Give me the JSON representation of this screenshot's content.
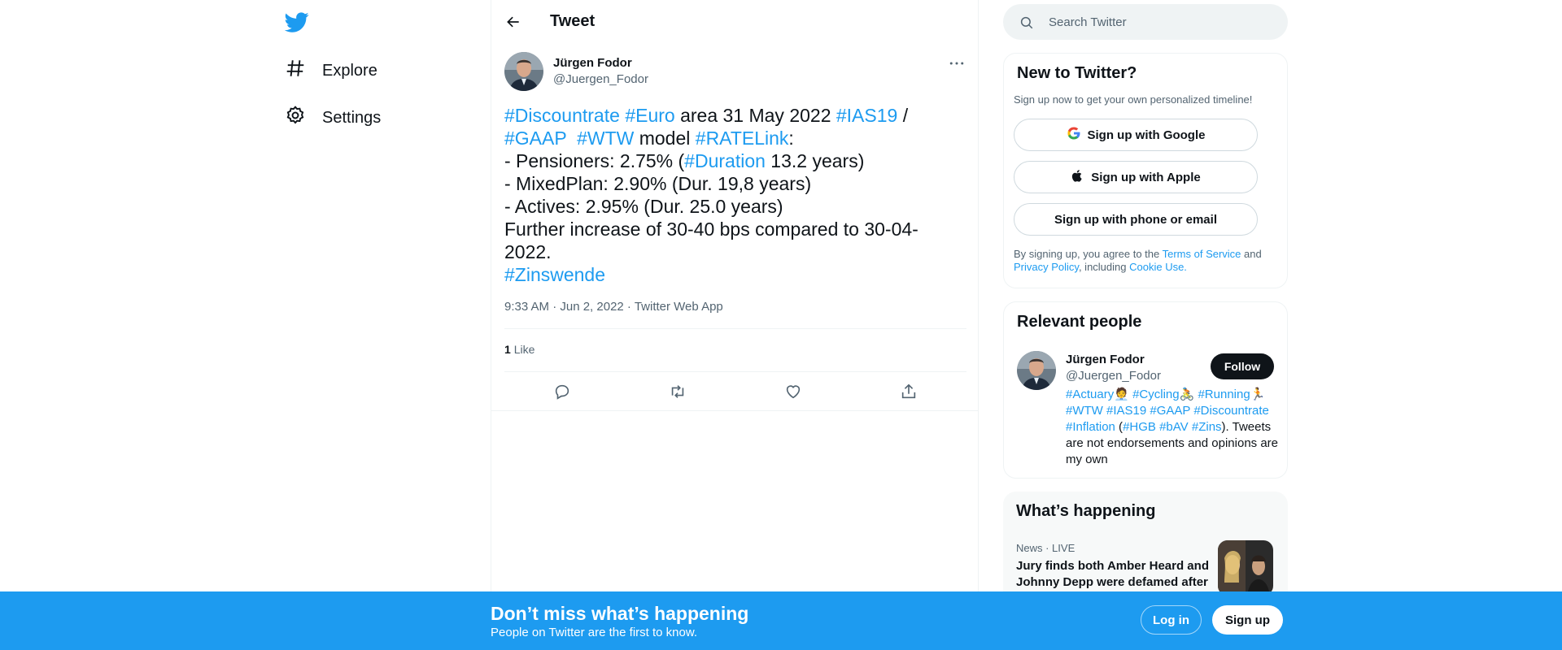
{
  "nav": {
    "items": [
      {
        "label": "Explore",
        "icon": "hashtag-icon"
      },
      {
        "label": "Settings",
        "icon": "gear-icon"
      }
    ]
  },
  "header": {
    "title": "Tweet"
  },
  "tweet": {
    "author_name": "Jürgen Fodor",
    "author_handle": "@Juergen_Fodor",
    "segments": [
      {
        "text": "#Discountrate",
        "tag": true
      },
      {
        "text": " ",
        "tag": false
      },
      {
        "text": "#Euro",
        "tag": true
      },
      {
        "text": " area 31 May 2022 ",
        "tag": false
      },
      {
        "text": "#IAS19",
        "tag": true
      },
      {
        "text": " /\n",
        "tag": false
      },
      {
        "text": "#GAAP",
        "tag": true
      },
      {
        "text": "  ",
        "tag": false
      },
      {
        "text": "#WTW",
        "tag": true
      },
      {
        "text": " model ",
        "tag": false
      },
      {
        "text": "#RATELink",
        "tag": true
      },
      {
        "text": ":\n- Pensioners: 2.75% (",
        "tag": false
      },
      {
        "text": "#Duration",
        "tag": true
      },
      {
        "text": " 13.2 years)\n- MixedPlan: 2.90% (Dur. 19,8 years)\n- Actives: 2.95% (Dur. 25.0 years)\nFurther increase of 30-40 bps compared to 30-04-2022.\n",
        "tag": false
      },
      {
        "text": "#Zinswende",
        "tag": true
      }
    ],
    "meta": "9:33 AM · Jun 2, 2022 · Twitter Web App",
    "like_count": "1",
    "like_label": "Like"
  },
  "sidebar": {
    "search_placeholder": "Search Twitter",
    "new_to_twitter": {
      "title": "New to Twitter?",
      "subtitle": "Sign up now to get your own personalized timeline!",
      "google_btn": "Sign up with Google",
      "apple_btn": "Sign up with Apple",
      "phone_btn": "Sign up with phone or email",
      "legal_prefix": "By signing up, you agree to the ",
      "terms": "Terms of Service",
      "and": " and ",
      "privacy": "Privacy Policy",
      "including": ", including ",
      "cookie": "Cookie Use."
    },
    "relevant_people": {
      "title": "Relevant people",
      "name": "Jürgen Fodor",
      "handle": "@Juergen_Fodor",
      "follow": "Follow",
      "bio_segments": [
        {
          "text": "#Actuary",
          "tag": true
        },
        {
          "text": "🧑‍💼 ",
          "tag": false
        },
        {
          "text": "#Cycling",
          "tag": true
        },
        {
          "text": "🚴 ",
          "tag": false
        },
        {
          "text": "#Running",
          "tag": true
        },
        {
          "text": "🏃 ",
          "tag": false
        },
        {
          "text": "#WTW",
          "tag": true
        },
        {
          "text": " ",
          "tag": false
        },
        {
          "text": "#IAS19",
          "tag": true
        },
        {
          "text": " ",
          "tag": false
        },
        {
          "text": "#GAAP",
          "tag": true
        },
        {
          "text": " ",
          "tag": false
        },
        {
          "text": "#Discountrate",
          "tag": true
        },
        {
          "text": " ",
          "tag": false
        },
        {
          "text": "#Inflation",
          "tag": true
        },
        {
          "text": " (",
          "tag": false
        },
        {
          "text": "#HGB",
          "tag": true
        },
        {
          "text": " ",
          "tag": false
        },
        {
          "text": "#bAV",
          "tag": true
        },
        {
          "text": " ",
          "tag": false
        },
        {
          "text": "#Zins",
          "tag": true
        },
        {
          "text": "). Tweets are not endorsements and opinions are my own",
          "tag": false
        }
      ]
    },
    "happening": {
      "title": "What’s happening",
      "news_meta": "News · LIVE",
      "news_title": "Jury finds both Amber Heard and Johnny Depp were defamed after"
    }
  },
  "bottom_bar": {
    "title": "Don’t miss what’s happening",
    "subtitle": "People on Twitter are the first to know.",
    "login": "Log in",
    "signup": "Sign up"
  },
  "colors": {
    "accent": "#1d9bf0",
    "text": "#0f1419",
    "muted": "#536471"
  }
}
